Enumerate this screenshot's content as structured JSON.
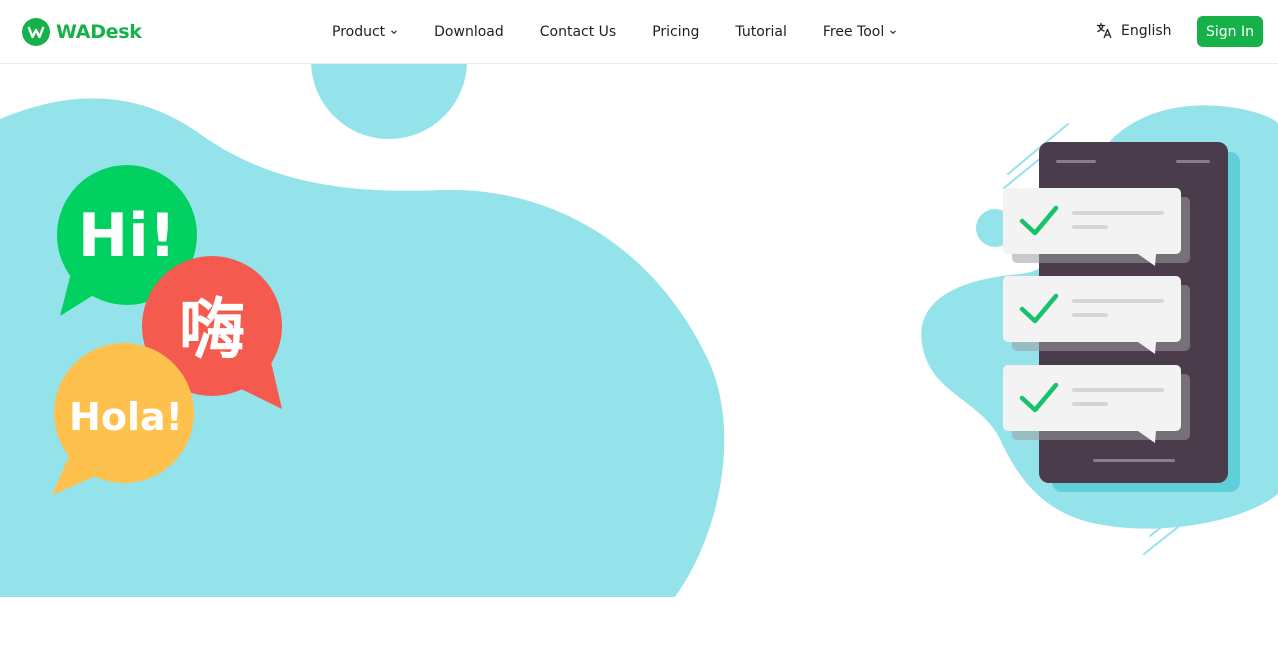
{
  "brand": {
    "name": "WADesk",
    "logo_letter": "W",
    "color": "#17b14a"
  },
  "nav": {
    "items": [
      {
        "label": "Product",
        "has_dropdown": true
      },
      {
        "label": "Download",
        "has_dropdown": false
      },
      {
        "label": "Contact Us",
        "has_dropdown": false
      },
      {
        "label": "Pricing",
        "has_dropdown": false
      },
      {
        "label": "Tutorial",
        "has_dropdown": false
      },
      {
        "label": "Free Tool",
        "has_dropdown": true
      }
    ]
  },
  "language": {
    "icon": "translate-icon",
    "label": "English"
  },
  "auth": {
    "signin_label": "Sign In"
  },
  "hero": {
    "bubbles": [
      {
        "text": "Hi!",
        "color": "#00d160"
      },
      {
        "text": "嗨",
        "color": "#f55a4e"
      },
      {
        "text": "Hola!",
        "color": "#ffc14d"
      }
    ],
    "blob_color": "#94e3eb",
    "phone_color": "#4a3c4a",
    "check_color": "#17c26a"
  }
}
